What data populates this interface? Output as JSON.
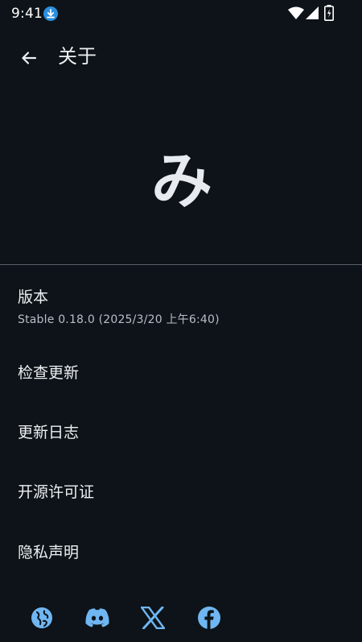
{
  "status_bar": {
    "time": "9:41"
  },
  "header": {
    "title": "关于"
  },
  "logo": {
    "glyph": "み"
  },
  "version": {
    "label": "版本",
    "value": "Stable 0.18.0 (2025/3/20 上午6:40)"
  },
  "menu": [
    {
      "label": "检查更新"
    },
    {
      "label": "更新日志"
    },
    {
      "label": "开源许可证"
    },
    {
      "label": "隐私声明"
    }
  ],
  "social_links": [
    "globe-icon",
    "discord-icon",
    "x-icon",
    "facebook-icon"
  ],
  "colors": {
    "background": "#0d1318",
    "accent": "#6fb6f2",
    "text": "#edf0f3",
    "subtext": "#b7bec6"
  }
}
